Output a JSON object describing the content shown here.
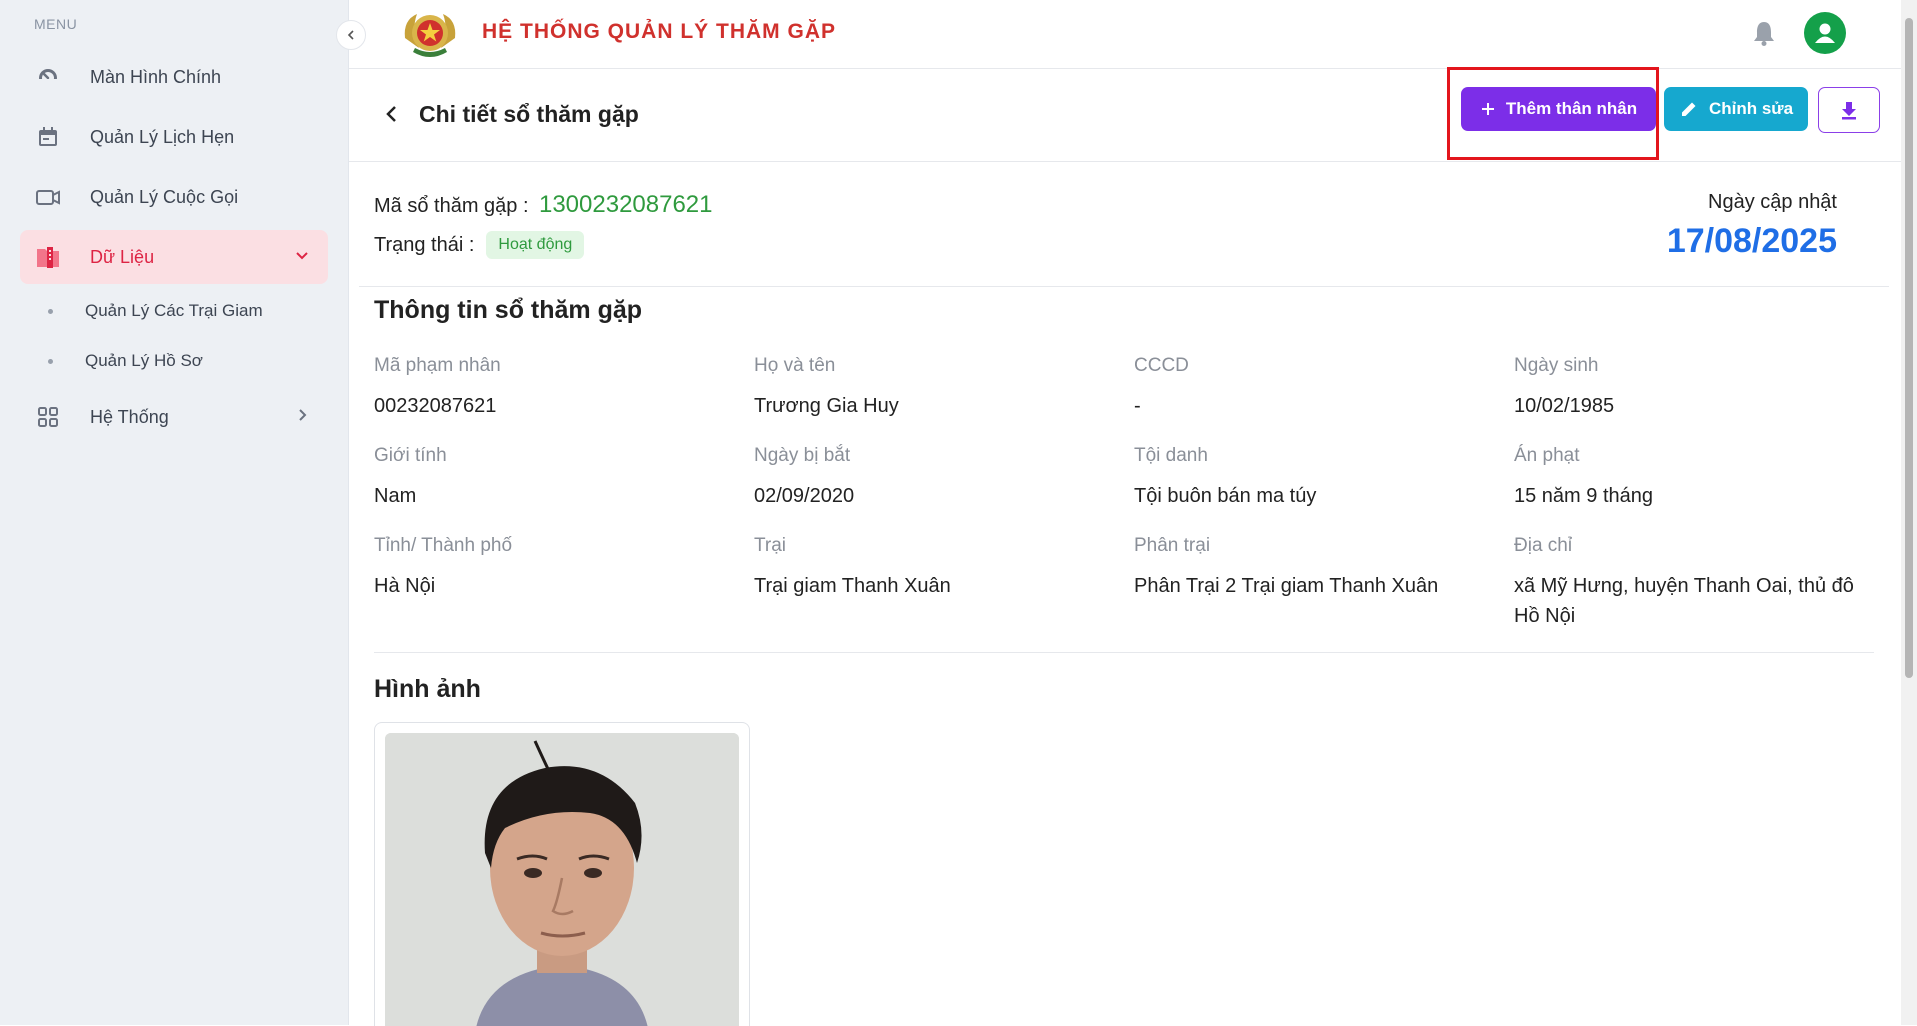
{
  "sidebar": {
    "menu_title": "MENU",
    "items": [
      {
        "label": "Màn Hình Chính",
        "icon": "dashboard-gauge-icon"
      },
      {
        "label": "Quản Lý Lịch Hẹn",
        "icon": "calendar-icon"
      },
      {
        "label": "Quản Lý Cuộc Gọi",
        "icon": "video-camera-icon"
      },
      {
        "label": "Dữ Liệu",
        "icon": "data-folder-icon",
        "active": true
      },
      {
        "label": "Hệ Thống",
        "icon": "grid-apps-icon"
      }
    ],
    "subitems": [
      {
        "label": "Quản Lý Các Trại Giam"
      },
      {
        "label": "Quản Lý Hồ Sơ"
      }
    ]
  },
  "topbar": {
    "title": "HỆ THỐNG QUẢN LÝ THĂM GẶP"
  },
  "header": {
    "page_title": "Chi tiết sổ thăm gặp",
    "add_label": "Thêm thân nhân",
    "edit_label": "Chỉnh sửa"
  },
  "summary": {
    "code_label": "Mã sổ thăm gặp :",
    "code_value": "1300232087621",
    "status_label": "Trạng thái :",
    "status_value": "Hoạt động",
    "updated_label": "Ngày cập nhật",
    "updated_value": "17/08/2025"
  },
  "info": {
    "title": "Thông tin sổ thăm gặp",
    "fields": [
      {
        "label": "Mã phạm nhân",
        "value": "00232087621"
      },
      {
        "label": "Họ và tên",
        "value": "Trương Gia Huy"
      },
      {
        "label": "CCCD",
        "value": "-"
      },
      {
        "label": "Ngày sinh",
        "value": "10/02/1985"
      },
      {
        "label": "Giới tính",
        "value": "Nam"
      },
      {
        "label": "Ngày bị bắt",
        "value": "02/09/2020"
      },
      {
        "label": "Tội danh",
        "value": "Tội buôn bán ma túy"
      },
      {
        "label": "Án phạt",
        "value": "15 năm 9 tháng"
      },
      {
        "label": "Tỉnh/ Thành phố",
        "value": "Hà Nội"
      },
      {
        "label": "Trại",
        "value": "Trại giam Thanh Xuân"
      },
      {
        "label": "Phân trại",
        "value": "Phân Trại 2 Trại giam Thanh Xuân"
      },
      {
        "label": "Địa chỉ",
        "value": "xã Mỹ Hưng, huyện Thanh Oai, thủ đô Hồ Nội"
      }
    ]
  },
  "images": {
    "title": "Hình ảnh"
  },
  "colors": {
    "accent_purple": "#7c2ee8",
    "accent_cyan": "#16a8cf",
    "active_red": "#dd2444",
    "code_green": "#2f9a3e",
    "date_blue": "#1f6ee6",
    "highlight_red": "#e3151c"
  }
}
